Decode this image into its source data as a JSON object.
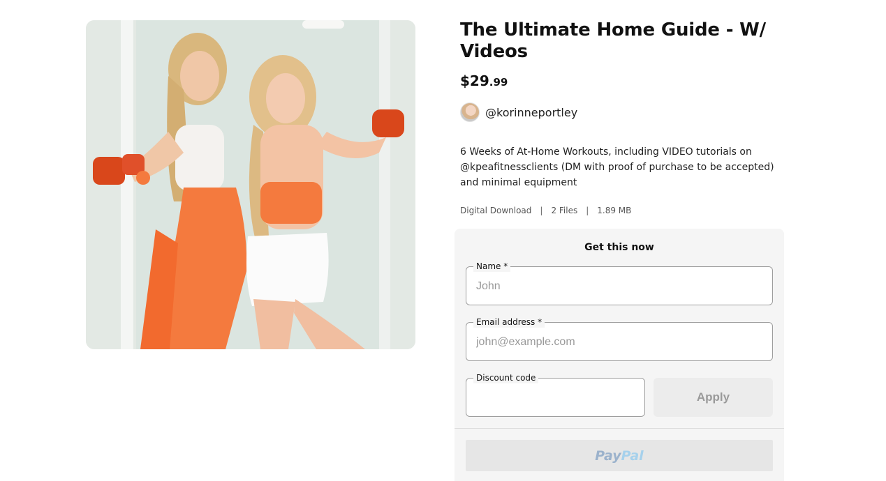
{
  "product": {
    "title": "The Ultimate Home Guide - W/ Videos",
    "price_main": "$29",
    "price_cents": ".99",
    "image_alt": "Two women posing back to back holding orange dumbbells"
  },
  "creator": {
    "handle": "@korinneportley"
  },
  "description": "6 Weeks of At-Home Workouts, including VIDEO tutorials on @kpeafitnessclients (DM with proof of purchase to be accepted) and minimal equipment",
  "meta": {
    "type": "Digital Download",
    "files": "2 Files",
    "size": "1.89 MB",
    "separator": "|"
  },
  "checkout": {
    "title": "Get this now",
    "name_label": "Name *",
    "name_placeholder": "John",
    "email_label": "Email address *",
    "email_placeholder": "john@example.com",
    "discount_label": "Discount code",
    "discount_placeholder": "",
    "apply_label": "Apply",
    "paypal_pay": "Pay",
    "paypal_pal": "Pal"
  },
  "colors": {
    "accent_orange": "#f26a2e",
    "card_bg": "#f5f5f5",
    "paypal_blue": "#9bb2cc"
  }
}
